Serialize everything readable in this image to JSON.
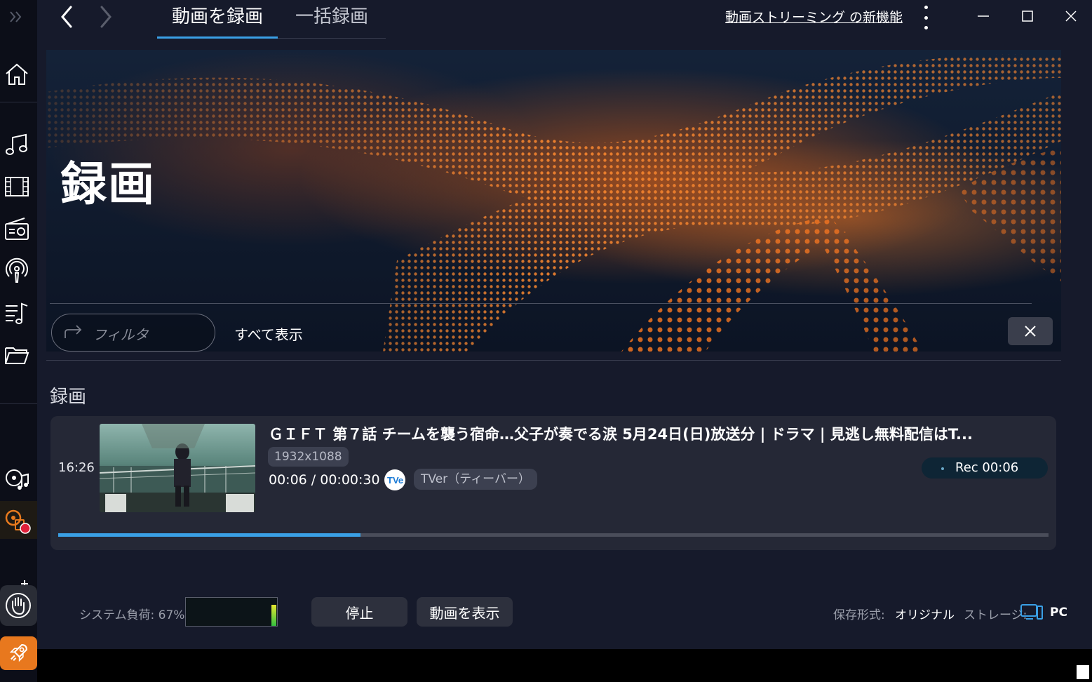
{
  "nav": {
    "back_icon": "chevron-left-icon",
    "forward_icon": "chevron-right-icon"
  },
  "tabs": [
    {
      "label": "動画を録画"
    },
    {
      "label": "一括録画"
    }
  ],
  "header": {
    "news_link": "動画ストリーミング の新機能"
  },
  "sidebar": {
    "items": [
      {
        "icon": "expand-icon"
      },
      {
        "icon": "home-icon"
      },
      {
        "icon": "music-icon"
      },
      {
        "icon": "film-icon"
      },
      {
        "icon": "radio-icon"
      },
      {
        "icon": "podcast-icon"
      },
      {
        "icon": "playlist-icon"
      },
      {
        "icon": "folder-icon"
      },
      {
        "icon": "music-recorder-icon"
      },
      {
        "icon": "video-recorder-icon"
      },
      {
        "icon": "hand-icon"
      },
      {
        "icon": "rocket-icon"
      }
    ],
    "accent_color": "#e87a1e",
    "record_color": "#e0203a"
  },
  "hero": {
    "title": "録画",
    "filter_placeholder": "フィルタ",
    "show_all": "すべて表示"
  },
  "section": {
    "title": "録画"
  },
  "recording": {
    "time": "16:26",
    "title": "ＧＩＦＴ 第７話 チームを襲う宿命…父子が奏でる涙 5月24日(日)放送分 | ドラマ | 見逃し無料配信はT...",
    "resolution": "1932x1088",
    "progress_text": "00:06 / 00:00:30",
    "source_icon_text": "TVer",
    "source": "TVer（ティーバー）",
    "status": "Rec 00:06",
    "progress_fraction": 0.305
  },
  "footer": {
    "system_load_label": "システム負荷:",
    "system_load_value": "67%",
    "stop_button": "停止",
    "show_video_button": "動画を表示",
    "format_label": "保存形式:",
    "format_value": "オリジナル",
    "storage_label": "ストレージ:",
    "storage_value": "PC"
  },
  "colors": {
    "accent_blue": "#3aa0e6",
    "background": "#161a2b"
  }
}
